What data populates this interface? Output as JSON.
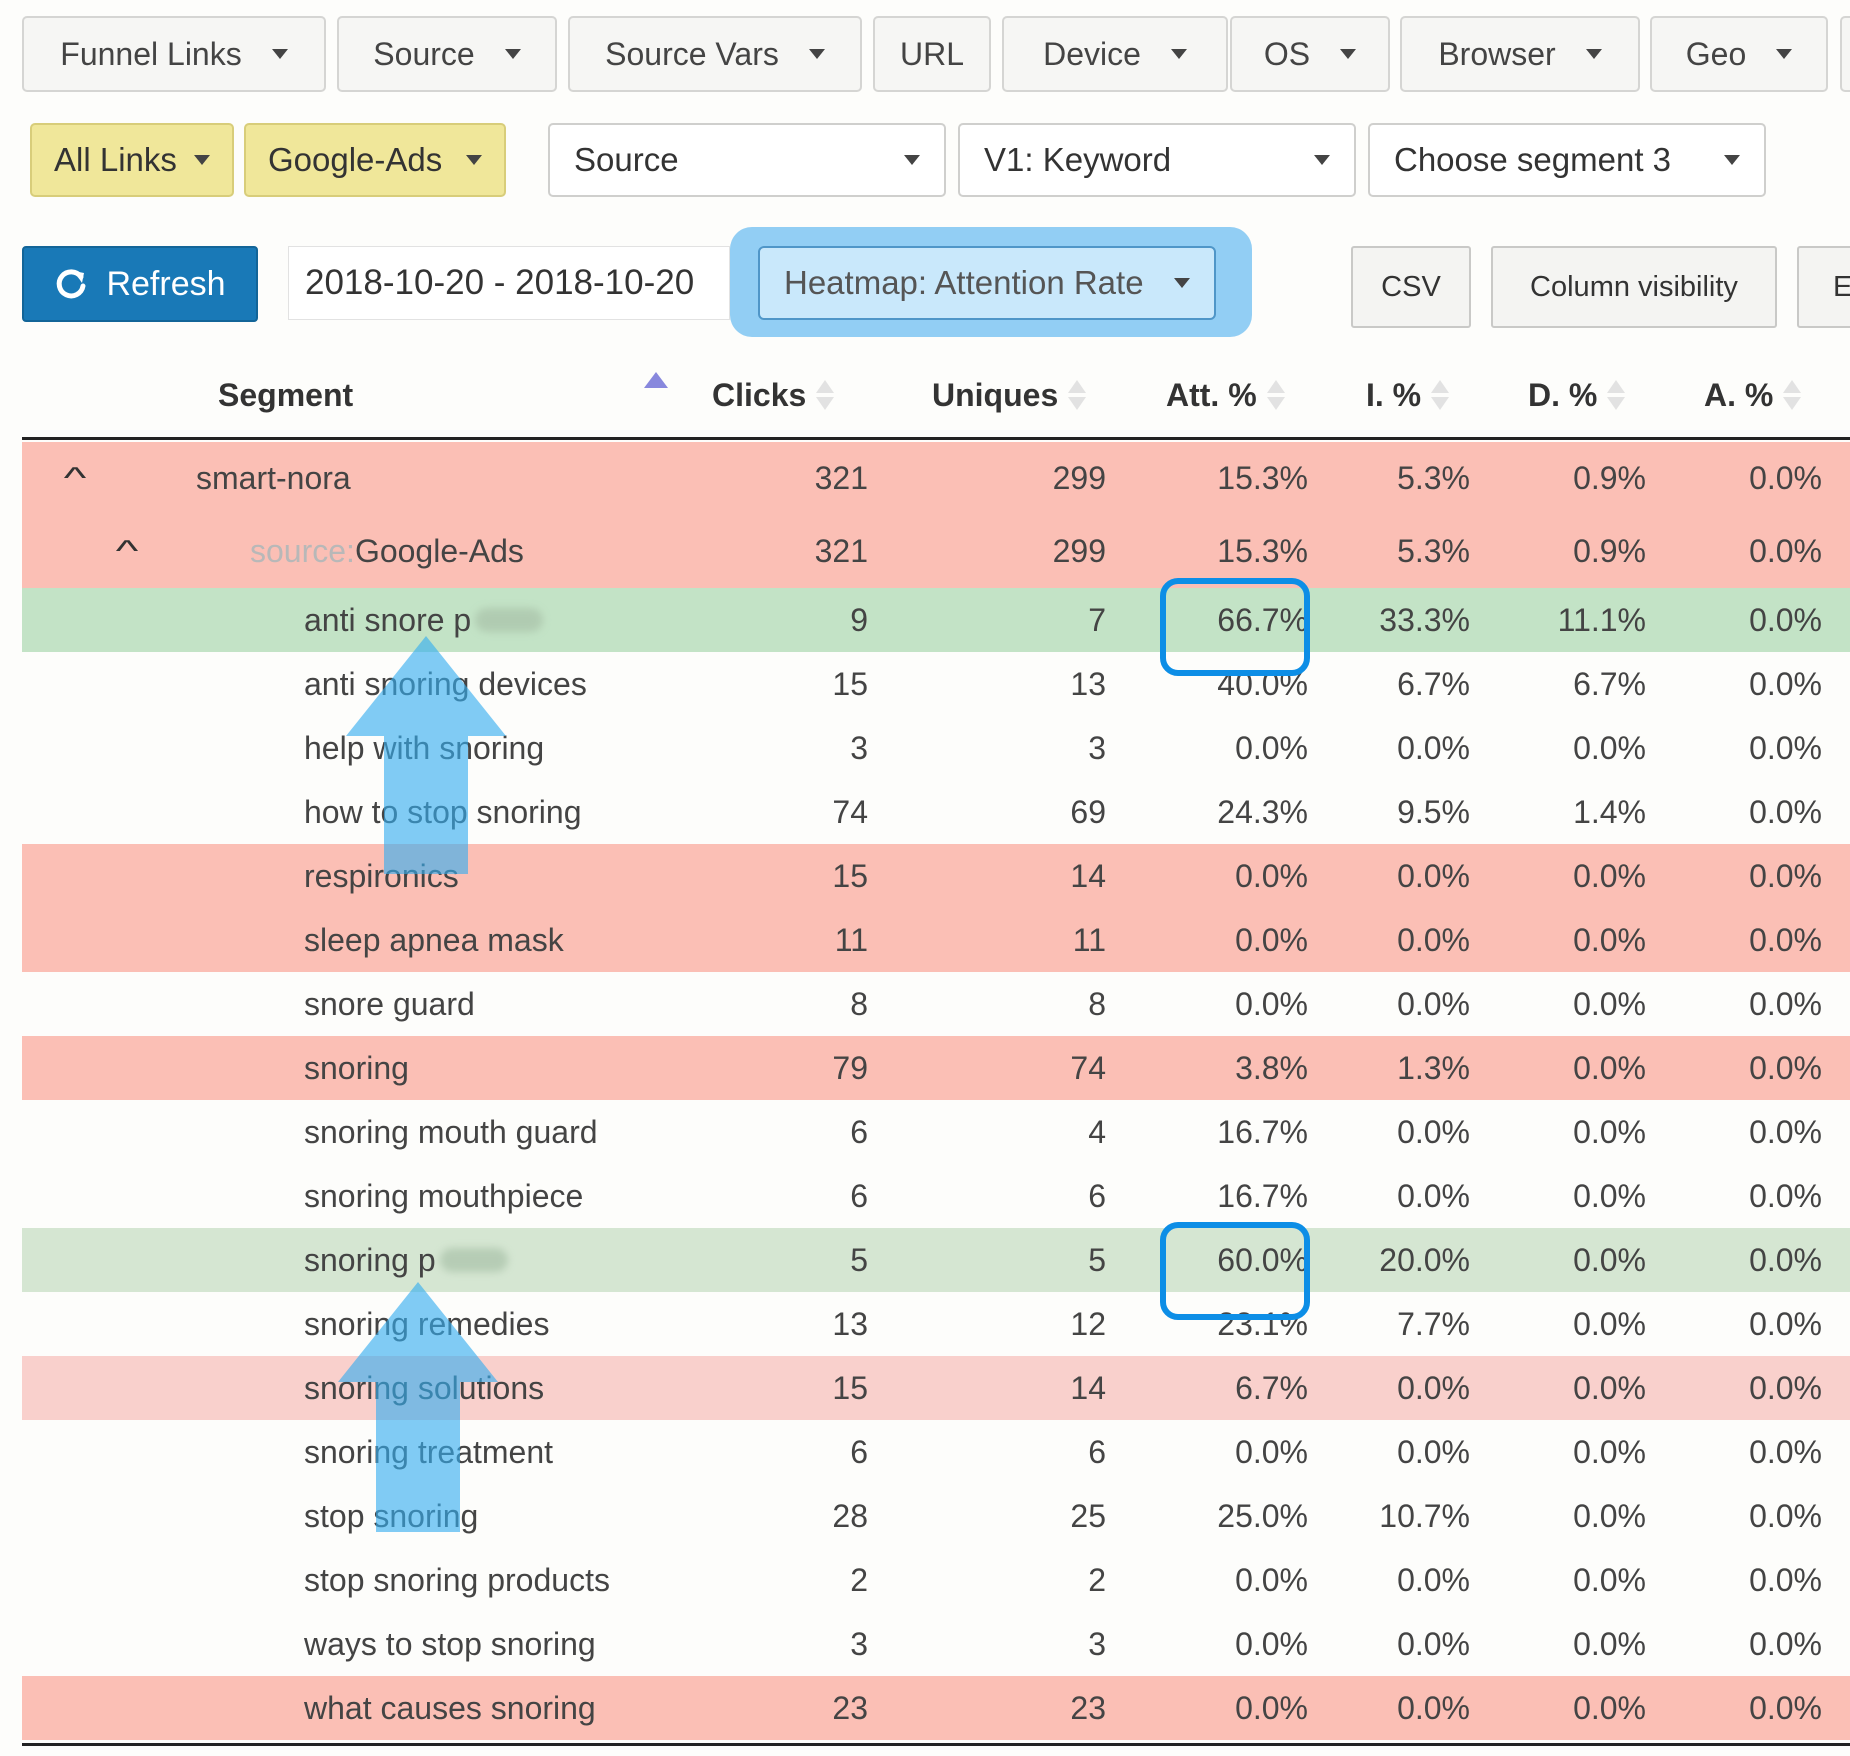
{
  "filter_tabs": [
    {
      "label": "Funnel Links",
      "dropdown": true
    },
    {
      "label": "Source",
      "dropdown": true
    },
    {
      "label": "Source Vars",
      "dropdown": true
    },
    {
      "label": "URL",
      "dropdown": false
    },
    {
      "label": "Device",
      "dropdown": true
    },
    {
      "label": "OS",
      "dropdown": true
    },
    {
      "label": "Browser",
      "dropdown": true
    },
    {
      "label": "Geo",
      "dropdown": true
    }
  ],
  "segment_filters": {
    "links": "All Links",
    "source": "Google-Ads",
    "segment1": "Source",
    "segment2": "V1: Keyword",
    "segment3": "Choose segment 3"
  },
  "toolbar": {
    "refresh_label": "Refresh",
    "date_range": "2018-10-20 - 2018-10-20",
    "heatmap_label": "Heatmap: Attention Rate",
    "csv_label": "CSV",
    "column_visibility_label": "Column visibility",
    "cut_off_button_label": "E"
  },
  "table": {
    "columns": [
      "Segment",
      "Clicks",
      "Uniques",
      "Att. %",
      "I. %",
      "D. %",
      "A. %"
    ],
    "sorted_column": "Segment",
    "colors": {
      "red": "#fbbfb5",
      "light_red": "#f9d0cc",
      "green": "#c3e3c6",
      "light_green": "#d5e6d2",
      "none": "#fdfdfb"
    },
    "rows": [
      {
        "level": 0,
        "prefix": "",
        "label": "smart-nora",
        "clicks": "321",
        "uniques": "299",
        "att": "15.3%",
        "i": "5.3%",
        "d": "0.9%",
        "a": "0.0%",
        "heat": "red",
        "expanded": true
      },
      {
        "level": 1,
        "prefix": "source: ",
        "label": "Google-Ads",
        "clicks": "321",
        "uniques": "299",
        "att": "15.3%",
        "i": "5.3%",
        "d": "0.9%",
        "a": "0.0%",
        "heat": "red",
        "expanded": true
      },
      {
        "level": 2,
        "prefix": "",
        "label": "anti snore p",
        "redacted": true,
        "clicks": "9",
        "uniques": "7",
        "att": "66.7%",
        "i": "33.3%",
        "d": "11.1%",
        "a": "0.0%",
        "heat": "green"
      },
      {
        "level": 2,
        "prefix": "",
        "label": "anti snoring devices",
        "clicks": "15",
        "uniques": "13",
        "att": "40.0%",
        "i": "6.7%",
        "d": "6.7%",
        "a": "0.0%",
        "heat": "none"
      },
      {
        "level": 2,
        "prefix": "",
        "label": "help with snoring",
        "clicks": "3",
        "uniques": "3",
        "att": "0.0%",
        "i": "0.0%",
        "d": "0.0%",
        "a": "0.0%",
        "heat": "none"
      },
      {
        "level": 2,
        "prefix": "",
        "label": "how to stop snoring",
        "clicks": "74",
        "uniques": "69",
        "att": "24.3%",
        "i": "9.5%",
        "d": "1.4%",
        "a": "0.0%",
        "heat": "none"
      },
      {
        "level": 2,
        "prefix": "",
        "label": "respironics",
        "clicks": "15",
        "uniques": "14",
        "att": "0.0%",
        "i": "0.0%",
        "d": "0.0%",
        "a": "0.0%",
        "heat": "red"
      },
      {
        "level": 2,
        "prefix": "",
        "label": "sleep apnea mask",
        "clicks": "11",
        "uniques": "11",
        "att": "0.0%",
        "i": "0.0%",
        "d": "0.0%",
        "a": "0.0%",
        "heat": "red"
      },
      {
        "level": 2,
        "prefix": "",
        "label": "snore guard",
        "clicks": "8",
        "uniques": "8",
        "att": "0.0%",
        "i": "0.0%",
        "d": "0.0%",
        "a": "0.0%",
        "heat": "none"
      },
      {
        "level": 2,
        "prefix": "",
        "label": "snoring",
        "clicks": "79",
        "uniques": "74",
        "att": "3.8%",
        "i": "1.3%",
        "d": "0.0%",
        "a": "0.0%",
        "heat": "red"
      },
      {
        "level": 2,
        "prefix": "",
        "label": "snoring mouth guard",
        "clicks": "6",
        "uniques": "4",
        "att": "16.7%",
        "i": "0.0%",
        "d": "0.0%",
        "a": "0.0%",
        "heat": "none"
      },
      {
        "level": 2,
        "prefix": "",
        "label": "snoring mouthpiece",
        "clicks": "6",
        "uniques": "6",
        "att": "16.7%",
        "i": "0.0%",
        "d": "0.0%",
        "a": "0.0%",
        "heat": "none"
      },
      {
        "level": 2,
        "prefix": "",
        "label": "snoring p",
        "redacted": true,
        "clicks": "5",
        "uniques": "5",
        "att": "60.0%",
        "i": "20.0%",
        "d": "0.0%",
        "a": "0.0%",
        "heat": "light_green"
      },
      {
        "level": 2,
        "prefix": "",
        "label": "snoring remedies",
        "clicks": "13",
        "uniques": "12",
        "att": "23.1%",
        "i": "7.7%",
        "d": "0.0%",
        "a": "0.0%",
        "heat": "none"
      },
      {
        "level": 2,
        "prefix": "",
        "label": "snoring solutions",
        "clicks": "15",
        "uniques": "14",
        "att": "6.7%",
        "i": "0.0%",
        "d": "0.0%",
        "a": "0.0%",
        "heat": "light_red"
      },
      {
        "level": 2,
        "prefix": "",
        "label": "snoring treatment",
        "clicks": "6",
        "uniques": "6",
        "att": "0.0%",
        "i": "0.0%",
        "d": "0.0%",
        "a": "0.0%",
        "heat": "none"
      },
      {
        "level": 2,
        "prefix": "",
        "label": "stop snoring",
        "clicks": "28",
        "uniques": "25",
        "att": "25.0%",
        "i": "10.7%",
        "d": "0.0%",
        "a": "0.0%",
        "heat": "none"
      },
      {
        "level": 2,
        "prefix": "",
        "label": "stop snoring products",
        "clicks": "2",
        "uniques": "2",
        "att": "0.0%",
        "i": "0.0%",
        "d": "0.0%",
        "a": "0.0%",
        "heat": "none"
      },
      {
        "level": 2,
        "prefix": "",
        "label": "ways to stop snoring",
        "clicks": "3",
        "uniques": "3",
        "att": "0.0%",
        "i": "0.0%",
        "d": "0.0%",
        "a": "0.0%",
        "heat": "none"
      },
      {
        "level": 2,
        "prefix": "",
        "label": "what causes snoring",
        "clicks": "23",
        "uniques": "23",
        "att": "0.0%",
        "i": "0.0%",
        "d": "0.0%",
        "a": "0.0%",
        "heat": "red"
      }
    ]
  },
  "annotations": {
    "highlight_color": "#0d8ee6",
    "arrow_color": "#35aef0",
    "highlighted_rows": [
      2,
      12
    ]
  }
}
